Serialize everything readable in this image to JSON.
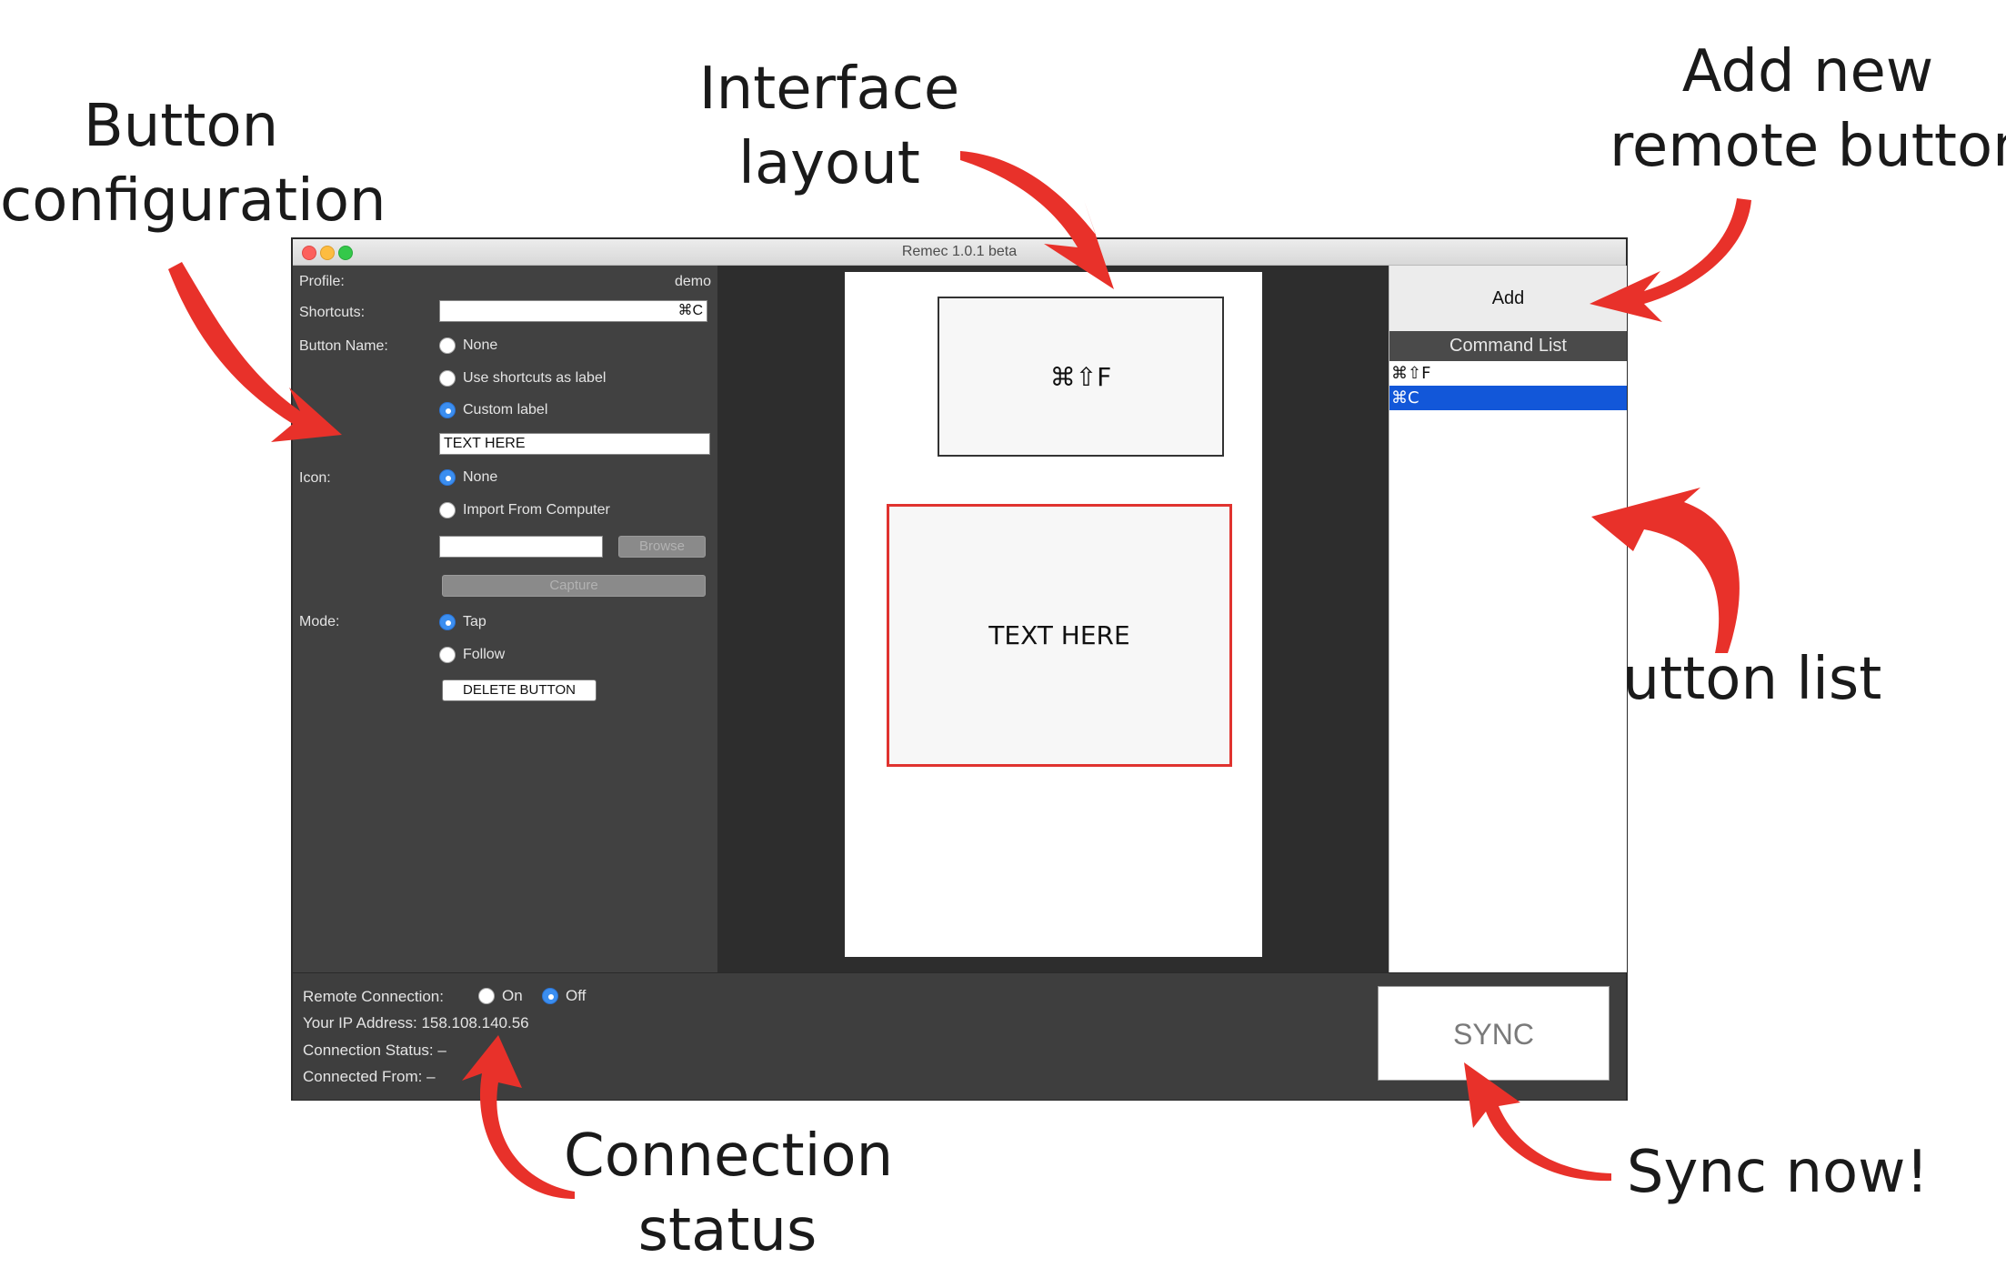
{
  "annotations": {
    "button_configuration": [
      "Button",
      "configuration"
    ],
    "interface_layout": [
      "Interface",
      "layout"
    ],
    "add_new_remote_button": [
      "Add new",
      "remote button"
    ],
    "button_list": "Button list",
    "connection_status": [
      "Connection",
      "status"
    ],
    "sync_now": "Sync now!"
  },
  "window": {
    "title": "Remec 1.0.1 beta"
  },
  "config": {
    "profile_label": "Profile:",
    "profile_value": "demo",
    "shortcuts_label": "Shortcuts:",
    "shortcuts_value": "⌘C",
    "button_name_label": "Button Name:",
    "button_name_options": [
      "None",
      "Use shortcuts as label",
      "Custom label"
    ],
    "button_name_selected": "Custom label",
    "custom_label_value": "TEXT HERE",
    "icon_label": "Icon:",
    "icon_options": [
      "None",
      "Import From Computer"
    ],
    "icon_selected": "None",
    "icon_path_value": "",
    "browse_label": "Browse",
    "capture_label": "Capture",
    "mode_label": "Mode:",
    "mode_options": [
      "Tap",
      "Follow"
    ],
    "mode_selected": "Tap",
    "delete_label": "DELETE BUTTON"
  },
  "layout": {
    "buttons": [
      {
        "label": "⌘⇧F",
        "selected": false
      },
      {
        "label": "TEXT HERE",
        "selected": true
      }
    ]
  },
  "command_panel": {
    "add_label": "Add",
    "list_title": "Command List",
    "items": [
      {
        "label": "⌘⇧F",
        "selected": false
      },
      {
        "label": "⌘C",
        "selected": true
      }
    ]
  },
  "connection": {
    "remote_label": "Remote Connection:",
    "on_label": "On",
    "off_label": "Off",
    "selected": "Off",
    "ip_label": "Your IP Address:",
    "ip_value": "158.108.140.56",
    "status_label": "Connection Status:",
    "status_value": "–",
    "from_label": "Connected From:",
    "from_value": "–"
  },
  "sync_label": "SYNC",
  "colors": {
    "arrow": "#e8312a",
    "selected_row": "#1257d9",
    "radio_on": "#3b8ef0",
    "selected_outline": "#e0332f"
  }
}
